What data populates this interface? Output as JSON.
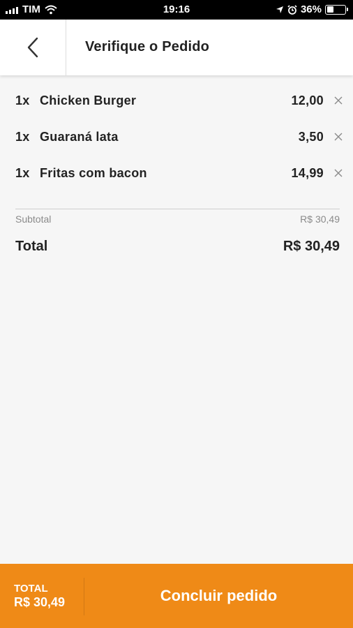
{
  "status_bar": {
    "carrier": "TIM",
    "time": "19:16",
    "battery_percent": "36%",
    "battery_level": 0.36,
    "icons": [
      "signal-icon",
      "wifi-icon",
      "location-icon",
      "alarm-icon",
      "battery-icon"
    ]
  },
  "header": {
    "title": "Verifique o Pedido",
    "back_icon": "chevron-left-icon"
  },
  "items": [
    {
      "qty": "1x",
      "name": "Chicken Burger",
      "price": "12,00"
    },
    {
      "qty": "1x",
      "name": "Guaraná lata",
      "price": "3,50"
    },
    {
      "qty": "1x",
      "name": "Fritas com bacon",
      "price": "14,99"
    }
  ],
  "summary": {
    "subtotal_label": "Subtotal",
    "subtotal_value": "R$ 30,49",
    "total_label": "Total",
    "total_value": "R$ 30,49"
  },
  "footer": {
    "total_label": "TOTAL",
    "total_value": "R$ 30,49",
    "confirm_label": "Concluir pedido"
  },
  "colors": {
    "accent": "#ef8a17",
    "background": "#f6f6f6",
    "text": "#222222",
    "muted": "#8a8a8a"
  }
}
